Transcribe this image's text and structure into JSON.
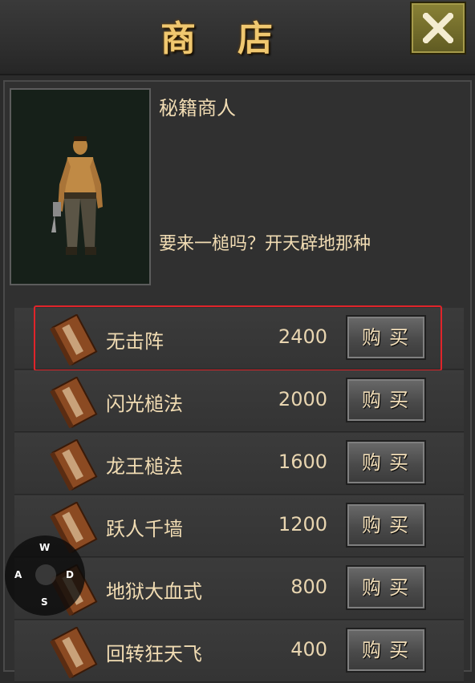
{
  "header": {
    "title": "商店",
    "close_icon": "close-x-icon"
  },
  "npc": {
    "name": "秘籍商人",
    "dialog": "要来一槌吗？开天辟地那种"
  },
  "shop": {
    "buy_label": "购买",
    "items": [
      {
        "name": "无击阵",
        "price": "2400",
        "icon": "skill-book-icon",
        "selected": true
      },
      {
        "name": "闪光槌法",
        "price": "2000",
        "icon": "skill-book-icon"
      },
      {
        "name": "龙王槌法",
        "price": "1600",
        "icon": "skill-book-icon"
      },
      {
        "name": "跃人千墙",
        "price": "1200",
        "icon": "skill-book-icon"
      },
      {
        "name": "地狱大血式",
        "price": "800",
        "icon": "skill-book-icon"
      },
      {
        "name": "回转狂天飞",
        "price": "400",
        "icon": "skill-book-icon"
      }
    ]
  },
  "joystick": {
    "up": "W",
    "left": "A",
    "right": "D",
    "down": "S"
  },
  "colors": {
    "title": "#f0c870",
    "text": "#f1dcb3",
    "selection": "#e0242a",
    "close_button": "#7a7230"
  }
}
